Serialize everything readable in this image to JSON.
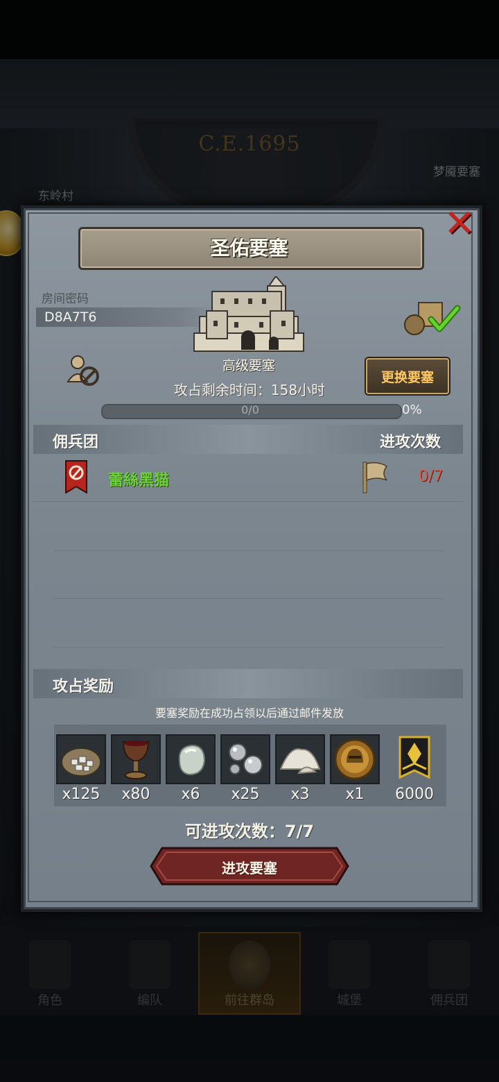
{
  "background": {
    "era_label": "C.E.1695",
    "map_label_left": "东岭村",
    "map_label_right": "梦魇要塞"
  },
  "bottom_nav": [
    {
      "label": "角色",
      "icon": "knight-icon",
      "active": false
    },
    {
      "label": "编队",
      "icon": "formation-icon",
      "active": false
    },
    {
      "label": "前往群岛",
      "icon": "compass-icon",
      "active": true
    },
    {
      "label": "城堡",
      "icon": "castle-icon",
      "active": false
    },
    {
      "label": "佣兵团",
      "icon": "mercenary-icon",
      "active": false
    }
  ],
  "dialog": {
    "title": "圣佑要塞",
    "close_icon": "close-icon",
    "room": {
      "label": "房间密码",
      "code": "D8A7T6"
    },
    "fortress": {
      "level_name": "高级要塞",
      "change_button": "更换要塞",
      "time_left": "攻占剩余时间：158小时",
      "progress_text": "0/0",
      "progress_percent": "0%",
      "progress_value": 0
    },
    "table": {
      "col_mercenary": "佣兵团",
      "col_attacks": "进攻次数",
      "rows": [
        {
          "name": "蕾絲黑猫",
          "attacks": "0/7"
        }
      ]
    },
    "rewards": {
      "title": "攻占奖励",
      "note": "要塞奖励在成功占领以后通过邮件发放",
      "items": [
        {
          "icon": "ore-sack-icon",
          "qty": "x125"
        },
        {
          "icon": "goblet-icon",
          "qty": "x80"
        },
        {
          "icon": "moonstone-icon",
          "qty": "x6"
        },
        {
          "icon": "silver-pearls-icon",
          "qty": "x25"
        },
        {
          "icon": "salt-pile-icon",
          "qty": "x3"
        },
        {
          "icon": "helmet-medal-icon",
          "qty": "x1"
        },
        {
          "icon": "rank-banner-icon",
          "qty": "6000"
        }
      ]
    },
    "remaining_attacks": "可进攻次数：7/7",
    "attack_button": "进攻要塞"
  },
  "colors": {
    "mercenary_name": "#6bd23a",
    "attack_count": "#e05a4c",
    "close": "#c4241f",
    "swap_text": "#ffc863",
    "attack_button": "#7a2a28"
  }
}
